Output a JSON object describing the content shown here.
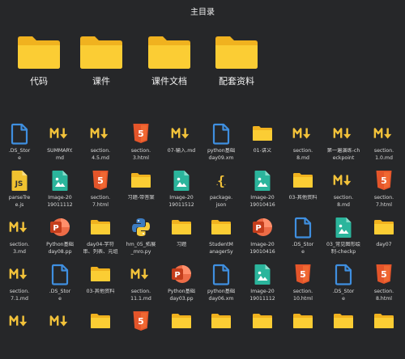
{
  "header": {
    "title": "主目录"
  },
  "top_folders": [
    {
      "label": "代码"
    },
    {
      "label": "课件"
    },
    {
      "label": "课件文档"
    },
    {
      "label": "配套资料"
    }
  ],
  "files": [
    {
      "type": "doc",
      "line1": ".DS_Stor",
      "line2": "e"
    },
    {
      "type": "md",
      "line1": "SUMMARY.",
      "line2": "md"
    },
    {
      "type": "md",
      "line1": "section.",
      "line2": "4.5.md"
    },
    {
      "type": "html",
      "line1": "section.",
      "line2": "3.html"
    },
    {
      "type": "md",
      "line1": "07-输入.md",
      "line2": ""
    },
    {
      "type": "doc",
      "line1": "python基础",
      "line2": "day09.xm"
    },
    {
      "type": "folder",
      "line1": "01-讲义",
      "line2": ""
    },
    {
      "type": "md",
      "line1": "section.",
      "line2": "8.md"
    },
    {
      "type": "md",
      "line1": "第一遍演练-ch",
      "line2": "eckpoint"
    },
    {
      "type": "md",
      "line1": "section.",
      "line2": "1.0.md"
    },
    {
      "type": "js",
      "line1": "parseTre",
      "line2": "e.js"
    },
    {
      "type": "image",
      "line1": "Image-20",
      "line2": "19011112"
    },
    {
      "type": "html",
      "line1": "section.",
      "line2": "7.html"
    },
    {
      "type": "folder",
      "line1": "习题-带答案",
      "line2": ""
    },
    {
      "type": "image",
      "line1": "Image-20",
      "line2": "19011512"
    },
    {
      "type": "json",
      "line1": "package.",
      "line2": "json"
    },
    {
      "type": "image",
      "line1": "Image-20",
      "line2": "19010416"
    },
    {
      "type": "folder",
      "line1": "03-其他资料",
      "line2": ""
    },
    {
      "type": "md",
      "line1": "section.",
      "line2": "8.md"
    },
    {
      "type": "html",
      "line1": "section.",
      "line2": "7.html"
    },
    {
      "type": "md",
      "line1": "section.",
      "line2": "3.md"
    },
    {
      "type": "ppt",
      "line1": "Python基础",
      "line2": "day08.pp"
    },
    {
      "type": "folder",
      "line1": "day04-字符",
      "line2": "串、列表、元组"
    },
    {
      "type": "python",
      "line1": "hm_05_拓展",
      "line2": "_mro.py"
    },
    {
      "type": "folder",
      "line1": "习题",
      "line2": ""
    },
    {
      "type": "folder",
      "line1": "StudentM",
      "line2": "anagerSy"
    },
    {
      "type": "ppt",
      "line1": "Image-20",
      "line2": "19010416"
    },
    {
      "type": "doc",
      "line1": ".DS_Stor",
      "line2": "e"
    },
    {
      "type": "image",
      "line1": "03_常见图形绘",
      "line2": "制-checkp"
    },
    {
      "type": "folder",
      "line1": "day07",
      "line2": ""
    },
    {
      "type": "md",
      "line1": "section.",
      "line2": "7.1.md"
    },
    {
      "type": "doc",
      "line1": ".DS_Stor",
      "line2": "e"
    },
    {
      "type": "folder",
      "line1": "03-其他资料",
      "line2": ""
    },
    {
      "type": "md",
      "line1": "section.",
      "line2": "11.1.md"
    },
    {
      "type": "ppt",
      "line1": "Python基础",
      "line2": "day03.pp"
    },
    {
      "type": "doc",
      "line1": "python基础",
      "line2": "day06.xm"
    },
    {
      "type": "image",
      "line1": "Image-20",
      "line2": "19011112"
    },
    {
      "type": "html",
      "line1": "section.",
      "line2": "10.html"
    },
    {
      "type": "doc",
      "line1": ".DS_Stor",
      "line2": "e"
    },
    {
      "type": "html",
      "line1": "section.",
      "line2": "8.html"
    },
    {
      "type": "md",
      "line1": "",
      "line2": ""
    },
    {
      "type": "md",
      "line1": "",
      "line2": ""
    },
    {
      "type": "folder",
      "line1": "",
      "line2": ""
    },
    {
      "type": "html",
      "line1": "",
      "line2": ""
    },
    {
      "type": "folder",
      "line1": "",
      "line2": ""
    },
    {
      "type": "folder",
      "line1": "",
      "line2": ""
    },
    {
      "type": "folder",
      "line1": "",
      "line2": ""
    },
    {
      "type": "folder",
      "line1": "",
      "line2": ""
    },
    {
      "type": "folder",
      "line1": "",
      "line2": ""
    },
    {
      "type": "folder",
      "line1": "",
      "line2": ""
    }
  ],
  "colors": {
    "background": "#262729",
    "folder": "#f8c32e",
    "doc": "#3f8fe0",
    "markdown": "#f2c23a",
    "html": "#e4552a",
    "image": "#2bb59c",
    "js": "#f0c230",
    "ppt": "#d24726"
  }
}
